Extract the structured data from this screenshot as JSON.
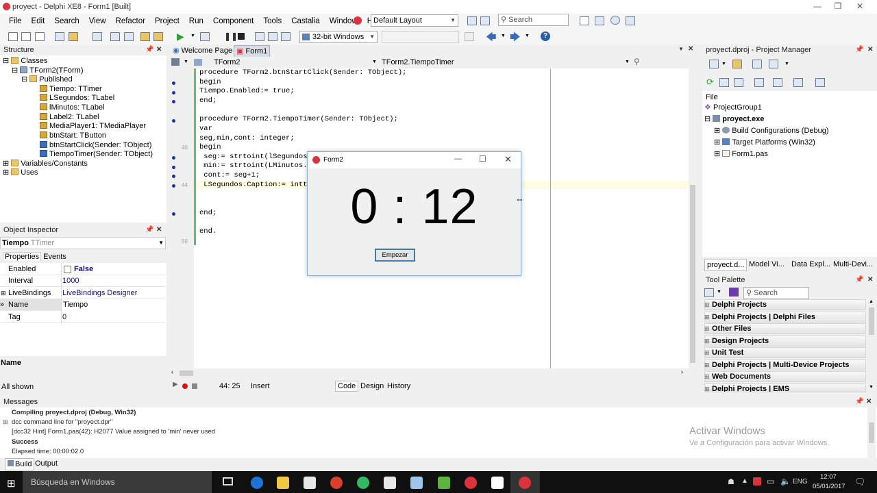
{
  "window": {
    "title": "proyect - Delphi XE8 - Form1 [Built]"
  },
  "menu": [
    "File",
    "Edit",
    "Search",
    "View",
    "Refactor",
    "Project",
    "Run",
    "Component",
    "Tools",
    "Castalia",
    "Window",
    "Help"
  ],
  "toolbar": {
    "layout": "Default Layout",
    "search_placeholder": "Search",
    "platform": "32-bit Windows"
  },
  "structure": {
    "title": "Structure",
    "items": [
      "Classes",
      "TForm2(TForm)",
      "Published",
      "Tiempo: TTimer",
      "LSegundos: TLabel",
      "lMinutos: TLabel",
      "Label2: TLabel",
      "MediaPlayer1: TMediaPlayer",
      "btnStart: TButton",
      "btnStartClick(Sender: TObject)",
      "TiempoTimer(Sender: TObject)",
      "Variables/Constants",
      "Uses"
    ]
  },
  "object_inspector": {
    "title": "Object Inspector",
    "component": "Tiempo",
    "component_type": "TTimer",
    "tabs": [
      "Properties",
      "Events"
    ],
    "rows": [
      {
        "name": "Enabled",
        "value": "False"
      },
      {
        "name": "Interval",
        "value": "1000"
      },
      {
        "name": "LiveBindings Des",
        "value": "LiveBindings Designer"
      },
      {
        "name": "Name",
        "value": "Tiempo"
      },
      {
        "name": "Tag",
        "value": "0"
      }
    ],
    "footer_label": "Name",
    "status": "All shown"
  },
  "editor": {
    "tabs": [
      "Welcome Page",
      "Form1"
    ],
    "class_combo": "TForm2",
    "method_combo": "TForm2.TiempoTimer",
    "lines": [
      "procedure TForm2.btnStartClick(Sender: TObject);",
      "begin",
      "Tiempo.Enabled:= true;",
      "end;",
      "",
      "procedure TForm2.TiempoTimer(Sender: TObject);",
      "var",
      "seg,min,cont: integer;",
      "begin",
      " seg:= strtoint(lSegundos.",
      " min:= strtoint(LMinutos.",
      " cont:= seg+1;",
      " LSegundos.Caption:= intt",
      "",
      "",
      "end;",
      "",
      "end."
    ],
    "line_numbers": [
      "40",
      "44",
      "50"
    ],
    "cursor_pos": "44: 25",
    "mode": "Insert",
    "bottom_tabs": [
      "Code",
      "Design",
      "History"
    ]
  },
  "form2": {
    "title": "Form2",
    "display": "0 : 12",
    "button": "Empezar"
  },
  "project_manager": {
    "title": "proyect.dproj - Project Manager",
    "file_label": "File",
    "items": [
      "ProjectGroup1",
      "proyect.exe",
      "Build Configurations (Debug)",
      "Target Platforms (Win32)",
      "Form1.pas"
    ],
    "tabs": [
      "proyect.d...",
      "Model Vi...",
      "Data Expl...",
      "Multi-Devi..."
    ]
  },
  "tool_palette": {
    "title": "Tool Palette",
    "search_placeholder": "Search",
    "categories": [
      "Delphi Projects",
      "Delphi Projects | Delphi Files",
      "Other Files",
      "Design Projects",
      "Unit Test",
      "Delphi Projects | Multi-Device Projects",
      "Web Documents",
      "Delphi Projects | EMS"
    ]
  },
  "messages": {
    "title": "Messages",
    "lines": [
      "Compiling proyect.dproj (Debug, Win32)",
      "dcc command line for \"proyect.dpr\"",
      "[dcc32 Hint] Form1.pas(42): H2077 Value assigned to 'min' never used",
      "Success",
      "Elapsed time: 00:00:02.0"
    ],
    "tabs": [
      "Build",
      "Output"
    ]
  },
  "watermark": {
    "line1": "Activar Windows",
    "line2": "Ve a Configuración para activar Windows."
  },
  "taskbar": {
    "search": "Búsqueda en Windows",
    "lang": "ENG",
    "time": "12:07",
    "date": "05/01/2017"
  }
}
